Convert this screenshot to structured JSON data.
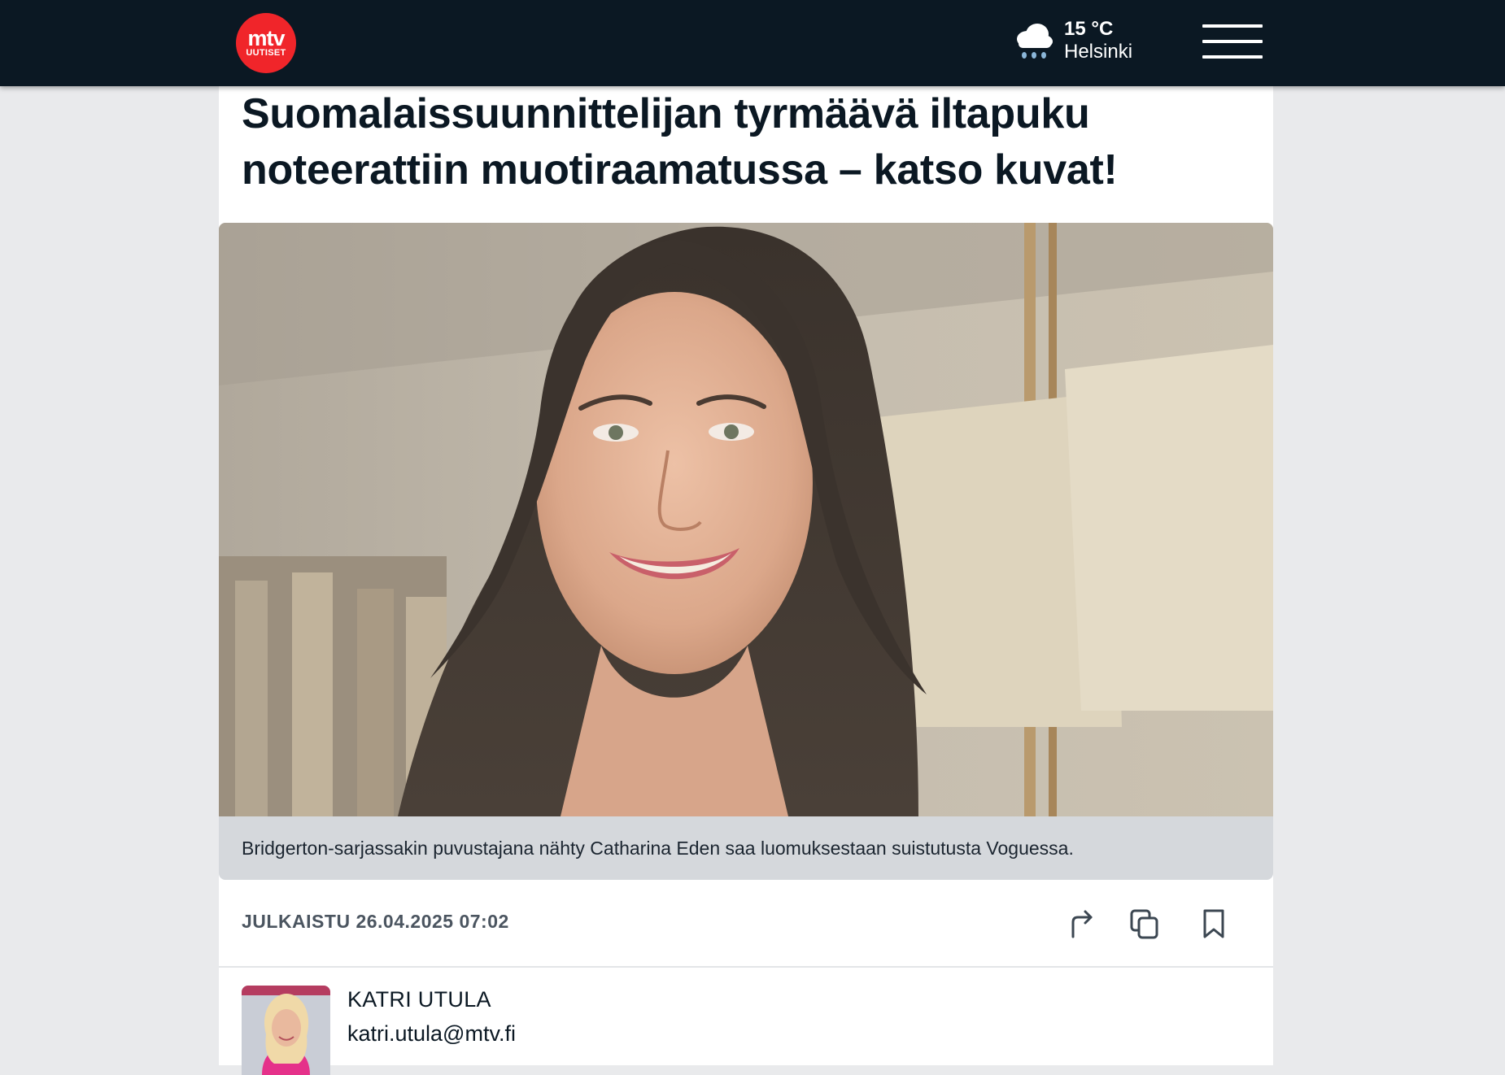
{
  "header": {
    "logo_top": "mtv",
    "logo_bottom": "UUTISET",
    "weather": {
      "icon": "cloud-rain-icon",
      "temperature": "15 °C",
      "city": "Helsinki"
    },
    "menu_icon": "hamburger-menu-icon"
  },
  "article": {
    "headline": "Suomalaissuunnittelijan tyrmäävä iltapuku noteerattiin muotiraamatussa – katso kuvat!",
    "image_caption": "Bridgerton-sarjassakin puvustajana nähty Catharina Eden saa luomuksestaan suistutusta Voguessa.",
    "published": "JULKAISTU 26.04.2025 07:02",
    "actions": [
      "share-icon",
      "copy-icon",
      "bookmark-icon"
    ]
  },
  "author": {
    "name": "KATRI UTULA",
    "email": "katri.utula@mtv.fi"
  },
  "colors": {
    "header_bg": "#0b1823",
    "logo_red": "#f0252a",
    "page_bg": "#e9eaec",
    "caption_bg": "#d5d8dc"
  }
}
